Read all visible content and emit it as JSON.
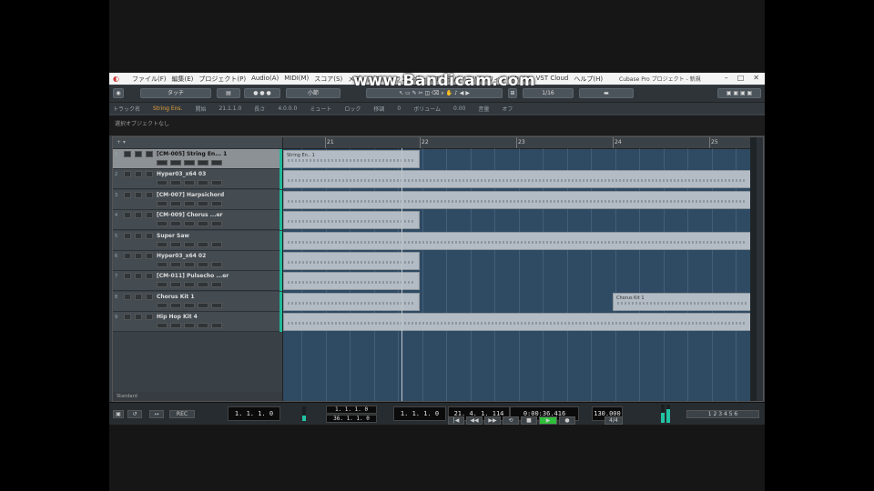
{
  "app": {
    "menu": [
      "ファイル(F)",
      "編集(E)",
      "プロジェクト(P)",
      "Audio(A)",
      "MIDI(M)",
      "スコア(S)",
      "メディア(D)",
      "トランスポート(T)",
      "デバイス(V)",
      "ウィンドウ(W)",
      "VST Cloud",
      "ヘルプ(H)"
    ],
    "title": "Cubase Pro プロジェクト - 新規",
    "window_buttons": [
      "–",
      "□",
      "✕"
    ]
  },
  "watermark": "www.Bandicam.com",
  "toolbar": {
    "mode_select": "タッチ",
    "grid_select": "小節",
    "quantize_select": "1/16"
  },
  "infoline": {
    "items": [
      "トラック名",
      "String Ens.",
      "開始",
      "21.1.1.0",
      "長さ",
      "4.0.0.0",
      "ミュート",
      "ロック",
      "移調",
      "0",
      "ボリューム",
      "0.00",
      "音量",
      "オフ"
    ],
    "highlight": "String Ens."
  },
  "statusline": "選択オブジェクトなし",
  "tracks": [
    {
      "num": "1",
      "name": "[CM-005] String En... 1",
      "selected": true
    },
    {
      "num": "2",
      "name": "Hyper03_x64 03",
      "selected": false
    },
    {
      "num": "3",
      "name": "[CM-007] Harpsichord",
      "selected": false
    },
    {
      "num": "4",
      "name": "[CM-009] Chorus ...er",
      "selected": false
    },
    {
      "num": "5",
      "name": "Super Saw",
      "selected": false
    },
    {
      "num": "6",
      "name": "Hyper03_x64 02",
      "selected": false
    },
    {
      "num": "7",
      "name": "[CM-011] Pulsecho ...er",
      "selected": false
    },
    {
      "num": "8",
      "name": "Chorus Kit 1",
      "selected": false
    },
    {
      "num": "9",
      "name": "Hip Hop Kit 4",
      "selected": false
    }
  ],
  "tracklist_footer": "Standard",
  "ruler_marks": [
    "21",
    "22",
    "23",
    "24",
    "25"
  ],
  "clip_labels": {
    "lane1": "String En.. 1",
    "lane8": "Chorus Kit 1"
  },
  "transport": {
    "left_locator": "1. 1. 1. 0",
    "punch_in": "1. 1. 1. 0",
    "punch_out": "36. 1. 1. 0",
    "position_bars": "21. 4. 1. 114",
    "position_time": "0:00:36.416",
    "tempo": "130.000",
    "signature": "4/4",
    "record_mode": "REC",
    "right_locator": "1. 1. 1. 0"
  },
  "meters": {
    "left_level": 0.35,
    "right_level": 0.55,
    "master_level": 0.75
  }
}
